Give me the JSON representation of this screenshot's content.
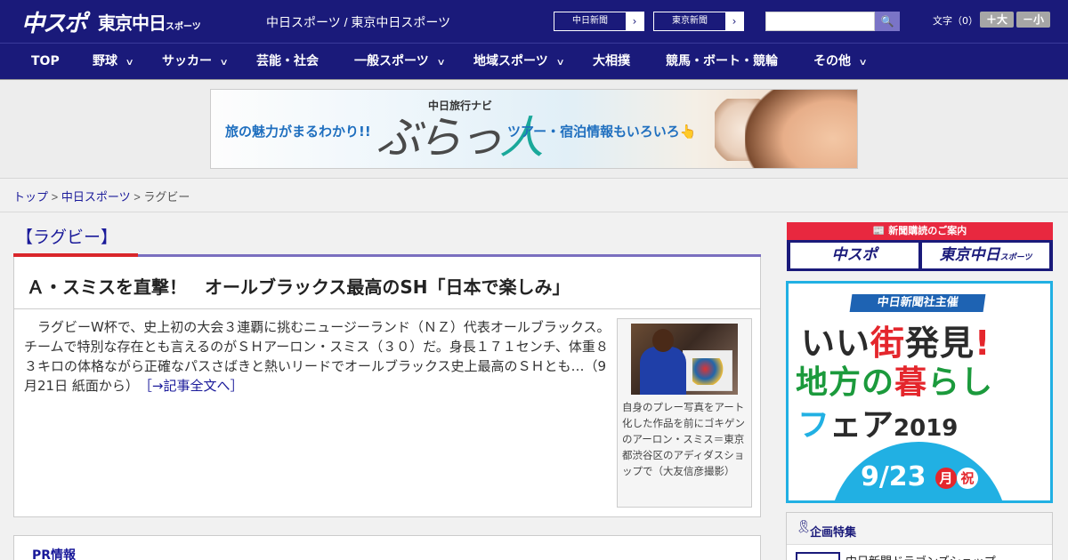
{
  "header": {
    "logo_chuspo": "中スポ",
    "logo_tokyo": "東京中日",
    "logo_tokyo_small": "スポーツ",
    "site_label": "中日スポーツ / 東京中日スポーツ",
    "select_chunichi": "中日新聞",
    "select_tokyo": "東京新聞",
    "select_arrow": "›",
    "search_placeholder": "",
    "search_icon": "🔍",
    "font_label": "文字（0）",
    "font_larger": "＋大",
    "font_smaller": "－小"
  },
  "nav": {
    "items": [
      {
        "label": "TOP",
        "has_menu": false
      },
      {
        "label": "野球",
        "has_menu": true
      },
      {
        "label": "サッカー",
        "has_menu": true
      },
      {
        "label": "芸能・社会",
        "has_menu": false
      },
      {
        "label": "一般スポーツ",
        "has_menu": true
      },
      {
        "label": "地域スポーツ",
        "has_menu": true
      },
      {
        "label": "大相撲",
        "has_menu": false
      },
      {
        "label": "競馬・ボート・競輪",
        "has_menu": false
      },
      {
        "label": "その他",
        "has_menu": true
      }
    ],
    "chevron": "∨"
  },
  "banner": {
    "left_text": "旅の魅力がまるわかり!!",
    "small_text": "中日旅行ナビ",
    "logo_text_a": "ぶらっ",
    "logo_text_b": "人",
    "right_text": "ツアー・宿泊情報もいろいろ👆"
  },
  "breadcrumb": {
    "home": "トップ",
    "sep1": " > ",
    "section": "中日スポーツ",
    "sep2": " > ",
    "current": "ラグビー"
  },
  "category": {
    "heading": "【ラグビー】"
  },
  "article": {
    "title": "Ａ・スミスを直撃！　オールブラックス最高のSH「日本で楽しみ」",
    "body": "　ラグビーW杯で、史上初の大会３連覇に挑むニュージーランド（ＮＺ）代表オールブラックス。チームで特別な存在とも言えるのがＳＨアーロン・スミス（３０）だ。身長１７１センチ、体重８３キロの体格ながら正確なパスさばきと熱いリードでオールブラックス史上最高のＳＨとも…（9月21日 紙面から）",
    "more_link": "［→記事全文へ］",
    "photo_caption": "自身のプレー写真をアート化した作品を前にゴキゲンのアーロン・スミス＝東京都渋谷区のアディダスショップで（大友信彦撮影）"
  },
  "pr": {
    "title": "PR情報"
  },
  "sidebar": {
    "subscription_head": "📰 新聞購読のご案内",
    "sub_chuspo": "中スポ",
    "sub_tokyo": "東京中日",
    "sub_tokyo_small": "スポーツ",
    "fair": {
      "sponsor": "中日新聞社主催",
      "line1_a": "いい",
      "line1_b": "街",
      "line1_c": "発見",
      "line1_d": "!",
      "line2_a": "地方の",
      "line2_b": "暮",
      "line2_c": "らし",
      "line3_a": "フ",
      "line3_b": "ェア",
      "line3_c": "2019",
      "date": "9/23",
      "dow1": "月",
      "dow2": "祝"
    },
    "feature": {
      "title": "企画特集",
      "item1": "中日新聞ドラゴンズショップ"
    }
  },
  "colors": {
    "brand_navy": "#1a1a7a",
    "accent_red": "#d9262b",
    "link_blue": "#1a1a9a",
    "fair_blue": "#21b0e3"
  }
}
